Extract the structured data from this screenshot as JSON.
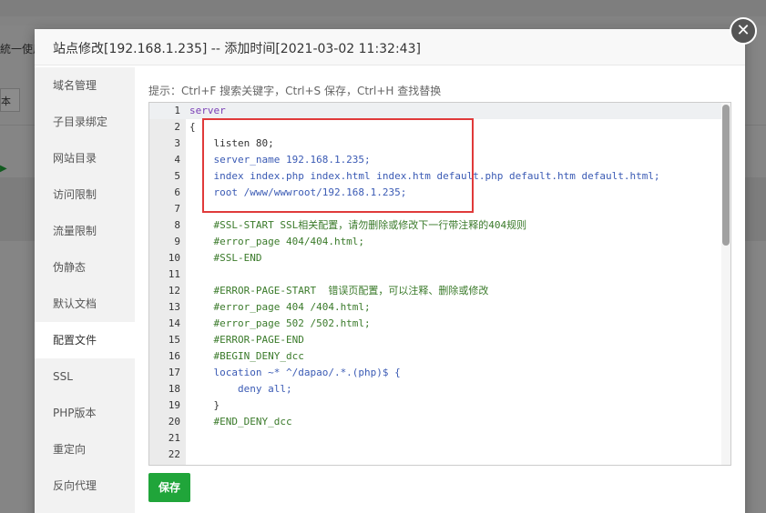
{
  "background": {
    "partial_text": "統一使用",
    "partial_button": "本"
  },
  "modal": {
    "title": "站点修改[192.168.1.235] -- 添加时间[2021-03-02 11:32:43]",
    "close_icon": "close-icon"
  },
  "sidebar": {
    "items": [
      {
        "label": "域名管理"
      },
      {
        "label": "子目录绑定"
      },
      {
        "label": "网站目录"
      },
      {
        "label": "访问限制"
      },
      {
        "label": "流量限制"
      },
      {
        "label": "伪静态"
      },
      {
        "label": "默认文档"
      },
      {
        "label": "配置文件"
      },
      {
        "label": "SSL"
      },
      {
        "label": "PHP版本"
      },
      {
        "label": "重定向"
      },
      {
        "label": "反向代理"
      }
    ],
    "active_index": 7
  },
  "content": {
    "hint": "提示：Ctrl+F 搜索关键字，Ctrl+S 保存，Ctrl+H 查找替换",
    "save_label": "保存"
  },
  "editor": {
    "lines": [
      {
        "n": "1",
        "text": "server"
      },
      {
        "n": "2",
        "text": "{"
      },
      {
        "n": "3",
        "text": "    listen 80;"
      },
      {
        "n": "4",
        "text": "    server_name 192.168.1.235;"
      },
      {
        "n": "5",
        "text": "    index index.php index.html index.htm default.php default.htm default.html;"
      },
      {
        "n": "6",
        "text": "    root /www/wwwroot/192.168.1.235;"
      },
      {
        "n": "7",
        "text": ""
      },
      {
        "n": "8",
        "text": "    #SSL-START SSL相关配置，请勿删除或修改下一行带注释的404规则"
      },
      {
        "n": "9",
        "text": "    #error_page 404/404.html;"
      },
      {
        "n": "10",
        "text": "    #SSL-END"
      },
      {
        "n": "11",
        "text": ""
      },
      {
        "n": "12",
        "text": "    #ERROR-PAGE-START  错误页配置，可以注释、删除或修改"
      },
      {
        "n": "13",
        "text": "    #error_page 404 /404.html;"
      },
      {
        "n": "14",
        "text": "    #error_page 502 /502.html;"
      },
      {
        "n": "15",
        "text": "    #ERROR-PAGE-END"
      },
      {
        "n": "16",
        "text": "    #BEGIN_DENY_dcc"
      },
      {
        "n": "17",
        "text": "    location ~* ^/dapao/.*.(php)$ {"
      },
      {
        "n": "18",
        "text": "        deny all;"
      },
      {
        "n": "19",
        "text": "    }"
      },
      {
        "n": "20",
        "text": "    #END_DENY_dcc"
      },
      {
        "n": "21",
        "text": ""
      },
      {
        "n": "22",
        "text": ""
      }
    ]
  },
  "colors": {
    "save_button": "#20a53a",
    "highlight_box": "#e03a3a"
  }
}
